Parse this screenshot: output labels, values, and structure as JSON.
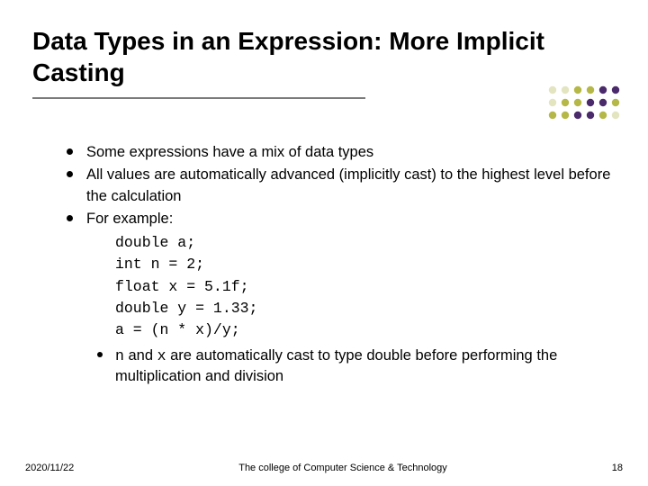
{
  "title": "Data Types in an Expression: More Implicit Casting",
  "bullets": {
    "b1": "Some expressions have a mix of data types",
    "b2": "All values are automatically advanced (implicitly cast) to the highest level before the calculation",
    "b3_lead": "For example:",
    "code": {
      "l1": "double a;",
      "l2": "int n = 2;",
      "l3": "float x = 5.1f;",
      "l4": "double y = 1.33;",
      "l5": "a = (n * x)/y;"
    },
    "sub": {
      "pre": "n",
      "mid": " and ",
      "var2": "x",
      "rest": " are automatically cast to type double before performing the multiplication and division"
    }
  },
  "footer": {
    "date": "2020/11/22",
    "center": "The college of Computer Science & Technology",
    "page": "18"
  },
  "deco": {
    "colors": {
      "purple": "#4b2a6b",
      "olive": "#b5b847",
      "pale": "#e3e4c0"
    }
  }
}
